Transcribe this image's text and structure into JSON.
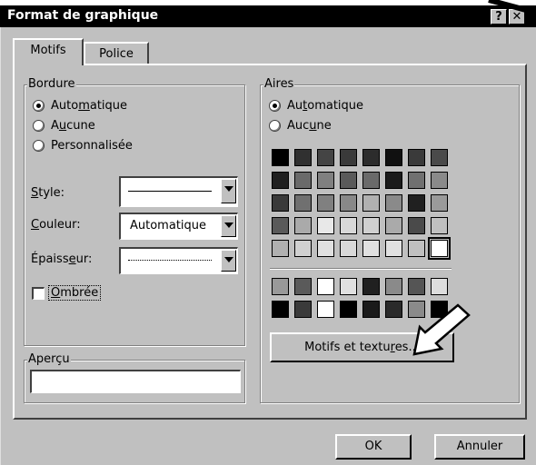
{
  "window": {
    "title": "Format de graphique",
    "help_button": "?",
    "close_button": "✕"
  },
  "tabs": [
    {
      "label": "Motifs",
      "active": true
    },
    {
      "label": "Police",
      "active": false
    }
  ],
  "bordure": {
    "legend": "Bordure",
    "options": [
      {
        "pre": "Auto",
        "key": "m",
        "post": "atique",
        "selected": true
      },
      {
        "pre": "A",
        "key": "u",
        "post": "cune",
        "selected": false
      },
      {
        "pre": "",
        "key": "",
        "post": "Personnalisée",
        "selected": false
      }
    ],
    "style": {
      "label_key": "S",
      "label_rest": "tyle:",
      "value": ""
    },
    "couleur": {
      "label_key": "C",
      "label_rest": "ouleur:",
      "value": "Automatique"
    },
    "epaisseur": {
      "label_pre": "Épaiss",
      "label_key": "e",
      "label_rest": "ur:",
      "value": ""
    },
    "ombree": {
      "label_key": "O",
      "label_rest": "mbrée",
      "checked": false
    }
  },
  "aires": {
    "legend": "Aires",
    "options": [
      {
        "pre": "Au",
        "key": "t",
        "post": "omatique",
        "selected": true
      },
      {
        "pre": "Auc",
        "key": "u",
        "post": "ne",
        "selected": false
      }
    ],
    "palette": [
      [
        "#000000",
        "#303030",
        "#444444",
        "#3a3a3a",
        "#2c2c2c",
        "#101010",
        "#3a3a3a",
        "#4a4a4a"
      ],
      [
        "#202020",
        "#6a6a6a",
        "#808080",
        "#5a5a5a",
        "#6a6a6a",
        "#1a1a1a",
        "#707070",
        "#8a8a8a"
      ],
      [
        "#3a3a3a",
        "#707070",
        "#808080",
        "#888888",
        "#b0b0b0",
        "#8a8a8a",
        "#202020",
        "#9a9a9a"
      ],
      [
        "#5a5a5a",
        "#aaaaaa",
        "#e8e8e8",
        "#d8d8d8",
        "#d0d0d0",
        "#aaaaaa",
        "#4a4a4a",
        "#c0c0c0"
      ],
      [
        "#b0b0b0",
        "#d0d0d0",
        "#e0e0e0",
        "#d8d8d8",
        "#e0e0e0",
        "#e0e0e0",
        "#c0c0c0",
        "#ffffff"
      ]
    ],
    "palette_extra": [
      [
        "#999999",
        "#5a5a5a",
        "#ffffff",
        "#e0e0e0",
        "#202020",
        "#8a8a8a",
        "#555555",
        "#dddddd"
      ],
      [
        "#000000",
        "#3a3a3a",
        "#ffffff",
        "#000000",
        "#1a1a1a",
        "#2a2a2a",
        "#8a8a8a",
        "#000000"
      ]
    ],
    "motifs_button": {
      "pre": "Motifs et textu",
      "key": "r",
      "post": "es..."
    }
  },
  "apercu": {
    "legend": "Aperçu"
  },
  "footer": {
    "ok": "OK",
    "cancel": "Annuler"
  },
  "colors": {
    "title_bar": "#000000",
    "face": "#c0c0c0",
    "shadow": "#808080",
    "dark": "#404040"
  }
}
